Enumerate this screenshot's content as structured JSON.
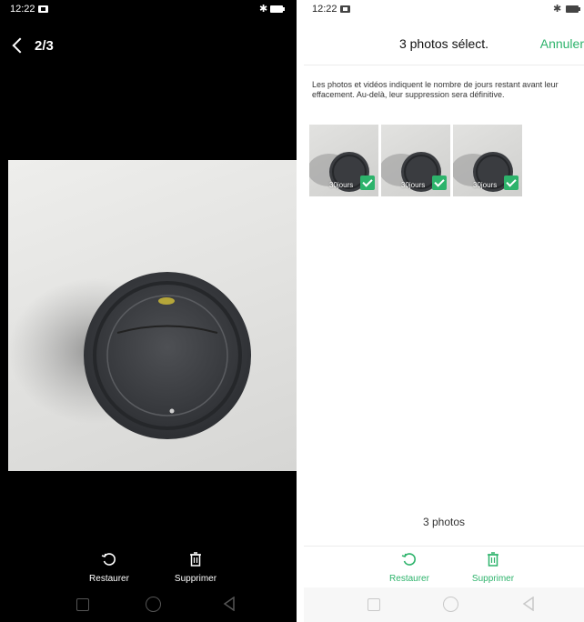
{
  "left_screen": {
    "status": {
      "time": "12:22"
    },
    "header": {
      "counter": "2/3"
    },
    "actions": {
      "restore_label": "Restaurer",
      "delete_label": "Supprimer"
    }
  },
  "right_screen": {
    "status": {
      "time": "12:22"
    },
    "header": {
      "title": "3 photos sélect.",
      "cancel_label": "Annuler"
    },
    "info_text": "Les photos et vidéos indiquent le nombre de jours restant avant leur effacement. Au-delà, leur suppression sera définitive.",
    "thumbnails": [
      {
        "days_label": "30jours",
        "selected": true
      },
      {
        "days_label": "30jours",
        "selected": true
      },
      {
        "days_label": "30jours",
        "selected": true
      }
    ],
    "count_text": "3 photos",
    "actions": {
      "restore_label": "Restaurer",
      "delete_label": "Supprimer"
    }
  },
  "icons": {
    "status": [
      "notification-icon",
      "bluetooth-icon",
      "battery-icon"
    ],
    "nav": [
      "recent-apps-icon",
      "home-icon",
      "back-icon"
    ],
    "actions": [
      "restore-icon",
      "trash-icon"
    ]
  },
  "colors": {
    "accent": "#2db36b",
    "left_background": "#000000",
    "right_background": "#ffffff"
  }
}
